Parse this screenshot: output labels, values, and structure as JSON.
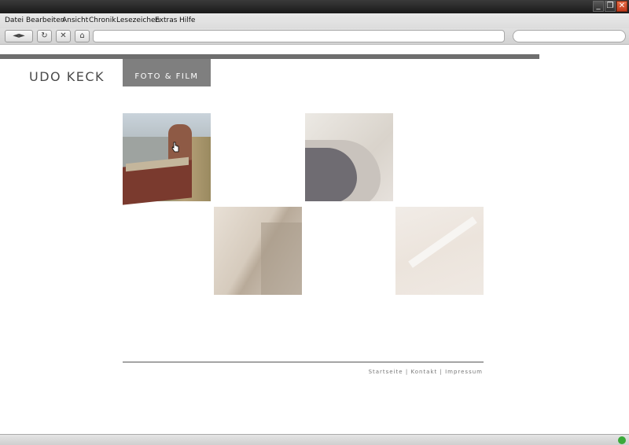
{
  "menu": {
    "items": [
      "Datei",
      "Bearbeiten",
      "Ansicht",
      "Chronik",
      "Lesezeichen",
      "Extras",
      "Hilfe"
    ]
  },
  "navbar": {
    "back_label": "◄",
    "forward_label": "►",
    "reload_label": "↻",
    "stop_label": "✕",
    "home_label": "⌂",
    "url_value": "",
    "search_value": ""
  },
  "site": {
    "brand": "UDO KECK",
    "nav_tab": "FOTO & FILM",
    "footer": {
      "links": [
        "Startseite",
        "Kontakt",
        "Impressum"
      ],
      "separator": "|"
    }
  },
  "window": {
    "minimize": "_",
    "maximize": "❐",
    "close": "✕"
  }
}
